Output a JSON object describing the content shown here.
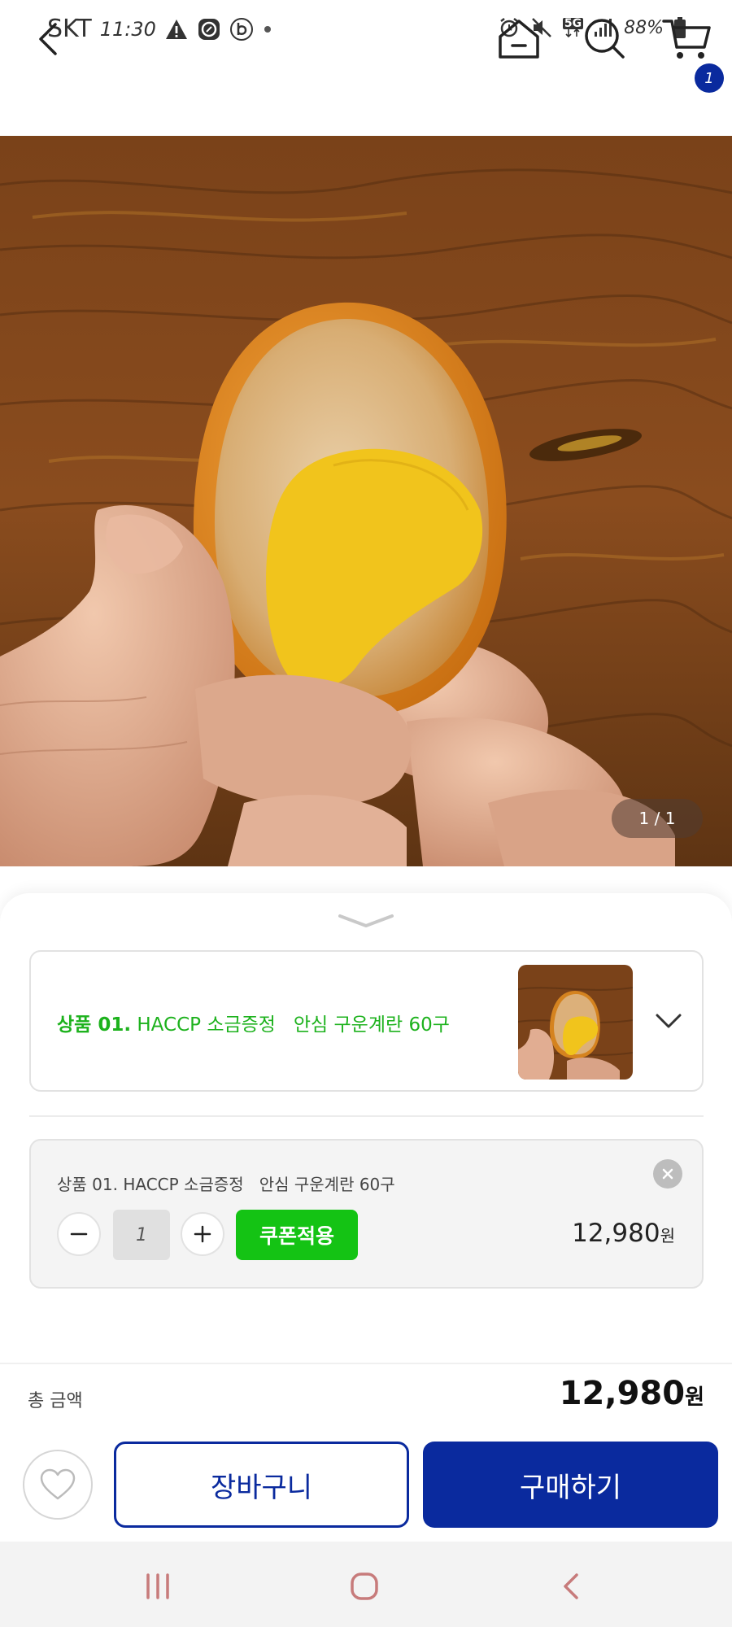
{
  "status_bar": {
    "carrier": "SKT",
    "time": "11:30",
    "battery": "88%",
    "network": "5G",
    "left_icons": [
      "warning-icon",
      "compass-icon",
      "b-app-icon",
      "dot-icon"
    ],
    "right_icons": [
      "alarm-icon",
      "mute-icon",
      "5g-icon",
      "signal-icon",
      "battery-icon"
    ]
  },
  "nav": {
    "cart_count": "1",
    "icons": [
      "back-icon",
      "home-icon",
      "search-icon",
      "cart-icon"
    ]
  },
  "product_image": {
    "counter": "1 / 1",
    "description": "peeled soy-sauce braised egg cut in half held in hand over wooden background"
  },
  "option_select": {
    "prefix": "상품 01.",
    "name": "HACCP 소금증정   안심 구운계란 60구"
  },
  "selected_item": {
    "name": "상품 01. HACCP 소금증정   안심 구운계란 60구",
    "quantity": "1",
    "coupon_label": "쿠폰적용",
    "price": "12,980",
    "currency": "원"
  },
  "total": {
    "label": "총 금액",
    "price": "12,980",
    "currency": "원"
  },
  "actions": {
    "cart_label": "장바구니",
    "buy_label": "구매하기"
  },
  "colors": {
    "brand_blue": "#0a2a9e",
    "option_green": "#1db21d",
    "coupon_green": "#14c314"
  }
}
